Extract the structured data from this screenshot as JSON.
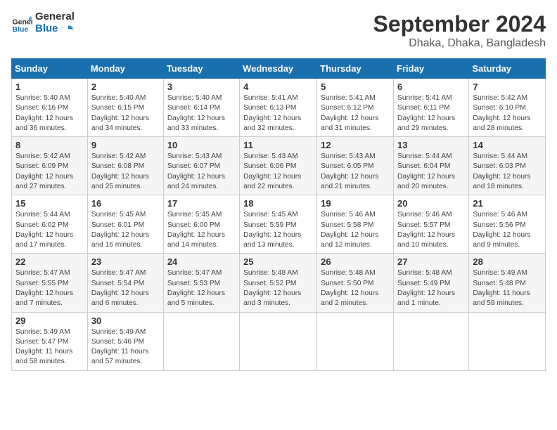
{
  "logo": {
    "text_general": "General",
    "text_blue": "Blue"
  },
  "title": "September 2024",
  "subtitle": "Dhaka, Dhaka, Bangladesh",
  "days_of_week": [
    "Sunday",
    "Monday",
    "Tuesday",
    "Wednesday",
    "Thursday",
    "Friday",
    "Saturday"
  ],
  "weeks": [
    [
      {
        "day": "1",
        "sunrise": "5:40 AM",
        "sunset": "6:16 PM",
        "daylight": "12 hours and 36 minutes."
      },
      {
        "day": "2",
        "sunrise": "5:40 AM",
        "sunset": "6:15 PM",
        "daylight": "12 hours and 34 minutes."
      },
      {
        "day": "3",
        "sunrise": "5:40 AM",
        "sunset": "6:14 PM",
        "daylight": "12 hours and 33 minutes."
      },
      {
        "day": "4",
        "sunrise": "5:41 AM",
        "sunset": "6:13 PM",
        "daylight": "12 hours and 32 minutes."
      },
      {
        "day": "5",
        "sunrise": "5:41 AM",
        "sunset": "6:12 PM",
        "daylight": "12 hours and 31 minutes."
      },
      {
        "day": "6",
        "sunrise": "5:41 AM",
        "sunset": "6:11 PM",
        "daylight": "12 hours and 29 minutes."
      },
      {
        "day": "7",
        "sunrise": "5:42 AM",
        "sunset": "6:10 PM",
        "daylight": "12 hours and 28 minutes."
      }
    ],
    [
      {
        "day": "8",
        "sunrise": "5:42 AM",
        "sunset": "6:09 PM",
        "daylight": "12 hours and 27 minutes."
      },
      {
        "day": "9",
        "sunrise": "5:42 AM",
        "sunset": "6:08 PM",
        "daylight": "12 hours and 25 minutes."
      },
      {
        "day": "10",
        "sunrise": "5:43 AM",
        "sunset": "6:07 PM",
        "daylight": "12 hours and 24 minutes."
      },
      {
        "day": "11",
        "sunrise": "5:43 AM",
        "sunset": "6:06 PM",
        "daylight": "12 hours and 22 minutes."
      },
      {
        "day": "12",
        "sunrise": "5:43 AM",
        "sunset": "6:05 PM",
        "daylight": "12 hours and 21 minutes."
      },
      {
        "day": "13",
        "sunrise": "5:44 AM",
        "sunset": "6:04 PM",
        "daylight": "12 hours and 20 minutes."
      },
      {
        "day": "14",
        "sunrise": "5:44 AM",
        "sunset": "6:03 PM",
        "daylight": "12 hours and 18 minutes."
      }
    ],
    [
      {
        "day": "15",
        "sunrise": "5:44 AM",
        "sunset": "6:02 PM",
        "daylight": "12 hours and 17 minutes."
      },
      {
        "day": "16",
        "sunrise": "5:45 AM",
        "sunset": "6:01 PM",
        "daylight": "12 hours and 16 minutes."
      },
      {
        "day": "17",
        "sunrise": "5:45 AM",
        "sunset": "6:00 PM",
        "daylight": "12 hours and 14 minutes."
      },
      {
        "day": "18",
        "sunrise": "5:45 AM",
        "sunset": "5:59 PM",
        "daylight": "12 hours and 13 minutes."
      },
      {
        "day": "19",
        "sunrise": "5:46 AM",
        "sunset": "5:58 PM",
        "daylight": "12 hours and 12 minutes."
      },
      {
        "day": "20",
        "sunrise": "5:46 AM",
        "sunset": "5:57 PM",
        "daylight": "12 hours and 10 minutes."
      },
      {
        "day": "21",
        "sunrise": "5:46 AM",
        "sunset": "5:56 PM",
        "daylight": "12 hours and 9 minutes."
      }
    ],
    [
      {
        "day": "22",
        "sunrise": "5:47 AM",
        "sunset": "5:55 PM",
        "daylight": "12 hours and 7 minutes."
      },
      {
        "day": "23",
        "sunrise": "5:47 AM",
        "sunset": "5:54 PM",
        "daylight": "12 hours and 6 minutes."
      },
      {
        "day": "24",
        "sunrise": "5:47 AM",
        "sunset": "5:53 PM",
        "daylight": "12 hours and 5 minutes."
      },
      {
        "day": "25",
        "sunrise": "5:48 AM",
        "sunset": "5:52 PM",
        "daylight": "12 hours and 3 minutes."
      },
      {
        "day": "26",
        "sunrise": "5:48 AM",
        "sunset": "5:50 PM",
        "daylight": "12 hours and 2 minutes."
      },
      {
        "day": "27",
        "sunrise": "5:48 AM",
        "sunset": "5:49 PM",
        "daylight": "12 hours and 1 minute."
      },
      {
        "day": "28",
        "sunrise": "5:49 AM",
        "sunset": "5:48 PM",
        "daylight": "11 hours and 59 minutes."
      }
    ],
    [
      {
        "day": "29",
        "sunrise": "5:49 AM",
        "sunset": "5:47 PM",
        "daylight": "11 hours and 58 minutes."
      },
      {
        "day": "30",
        "sunrise": "5:49 AM",
        "sunset": "5:46 PM",
        "daylight": "11 hours and 57 minutes."
      },
      null,
      null,
      null,
      null,
      null
    ]
  ],
  "labels": {
    "sunrise": "Sunrise:",
    "sunset": "Sunset:",
    "daylight": "Daylight:"
  }
}
